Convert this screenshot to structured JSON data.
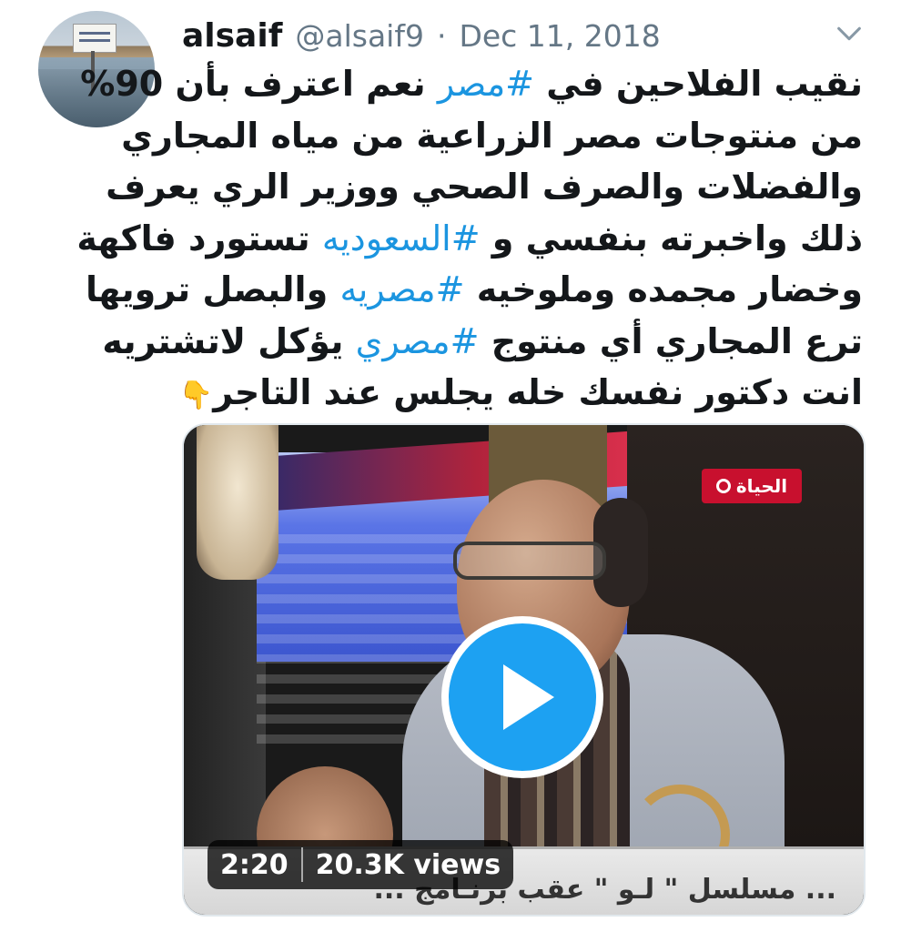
{
  "user": {
    "name": "alsaif",
    "handle": "@alsaif9",
    "separator": "·",
    "date": "Dec 11, 2018"
  },
  "tweet": {
    "lines": [
      {
        "before": "نقيب الفلاحين في ",
        "tag": "#مصر",
        "after": " نعم اعترف بأن 90%"
      },
      {
        "before": "من منتوجات مصر الزراعية من مياه المجاري",
        "tag": "",
        "after": ""
      },
      {
        "before": "والفضلات والصرف الصحي ووزير الري يعرف",
        "tag": "",
        "after": ""
      },
      {
        "before": "ذلك واخبرته بنفسي و ",
        "tag": "#السعوديه",
        "after": " تستورد فاكهة"
      },
      {
        "before": "وخضار مجمده وملوخيه ",
        "tag": "#مصريه",
        "after": " والبصل ترويها"
      },
      {
        "before": "ترع المجاري أي منتوج ",
        "tag": "#مصري",
        "after": " يؤكل لاتشتريه"
      },
      {
        "before": "انت دكتور نفسك خله يجلس عند التاجر",
        "tag": "",
        "after": "",
        "emoji": "👇"
      }
    ]
  },
  "media": {
    "duration": "2:20",
    "views": "20.3K views",
    "channel_logo": "الحياة",
    "ticker_text": "... مسلسل \" لـو \" عقب برنـامج ..."
  },
  "icons": {
    "chevron": "chevron-down-icon",
    "play": "play-icon"
  },
  "colors": {
    "hashtag": "#1b95e0",
    "play_button": "#1da1f2",
    "secondary_text": "#657786"
  }
}
